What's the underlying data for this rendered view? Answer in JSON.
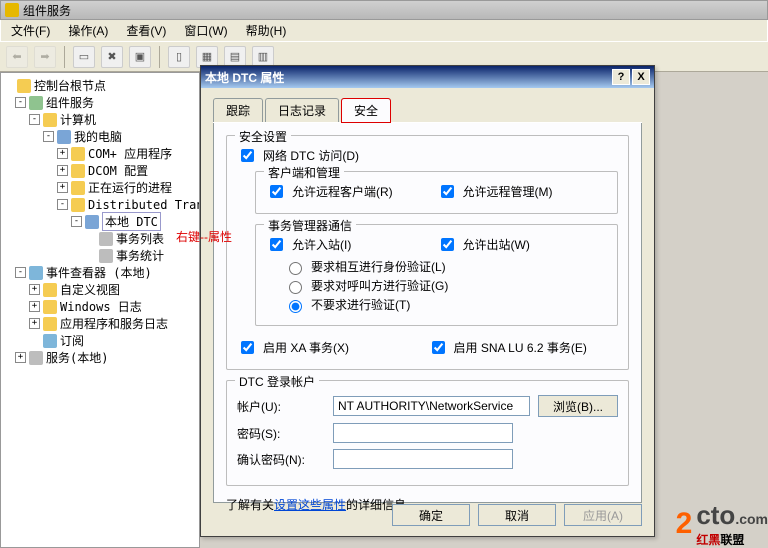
{
  "window": {
    "title": "组件服务"
  },
  "menu": {
    "file": "文件(F)",
    "action": "操作(A)",
    "view": "查看(V)",
    "window2": "窗口(W)",
    "help": "帮助(H)"
  },
  "tree": {
    "root": "控制台根节点",
    "comp_svc": "组件服务",
    "computers": "计算机",
    "my_pc": "我的电脑",
    "com_plus": "COM+ 应用程序",
    "dcom": "DCOM 配置",
    "running": "正在运行的进程",
    "dist_tran": "Distributed Tran",
    "local_dtc": "本地 DTC",
    "txn_list": "事务列表",
    "txn_stats": "事务统计",
    "event_viewer": "事件查看器 (本地)",
    "custom_views": "自定义视图",
    "win_log": "Windows 日志",
    "app_svc_log": "应用程序和服务日志",
    "subs": "订阅",
    "services": "服务(本地)"
  },
  "annotation": "右键--属性",
  "dialog": {
    "title": "本地 DTC 属性",
    "tabs": {
      "trace": "跟踪",
      "log": "日志记录",
      "security": "安全"
    },
    "sec_group": "安全设置",
    "net_dtc": "网络 DTC 访问(D)",
    "client_admin": "客户端和管理",
    "allow_remote_client": "允许远程客户端(R)",
    "allow_remote_admin": "允许远程管理(M)",
    "txn_mgr_comm": "事务管理器通信",
    "allow_inbound": "允许入站(I)",
    "allow_outbound": "允许出站(W)",
    "mutual_auth": "要求相互进行身份验证(L)",
    "caller_auth": "要求对呼叫方进行验证(G)",
    "no_auth": "不要求进行验证(T)",
    "enable_xa": "启用 XA 事务(X)",
    "enable_sna": "启用 SNA LU 6.2 事务(E)",
    "login_group": "DTC 登录帐户",
    "account_label": "帐户(U):",
    "account_value": "NT AUTHORITY\\NetworkService",
    "browse": "浏览(B)...",
    "password": "密码(S):",
    "confirm": "确认密码(N):",
    "info_prefix": "了解有关",
    "info_link": "设置这些属性",
    "info_suffix": "的详细信息。",
    "ok": "确定",
    "cancel": "取消",
    "apply": "应用(A)"
  },
  "watermark": {
    "two": "2",
    "cto": "cto",
    "dotcom": ".com",
    "zh1": "红黑",
    "zh2": "联盟"
  }
}
